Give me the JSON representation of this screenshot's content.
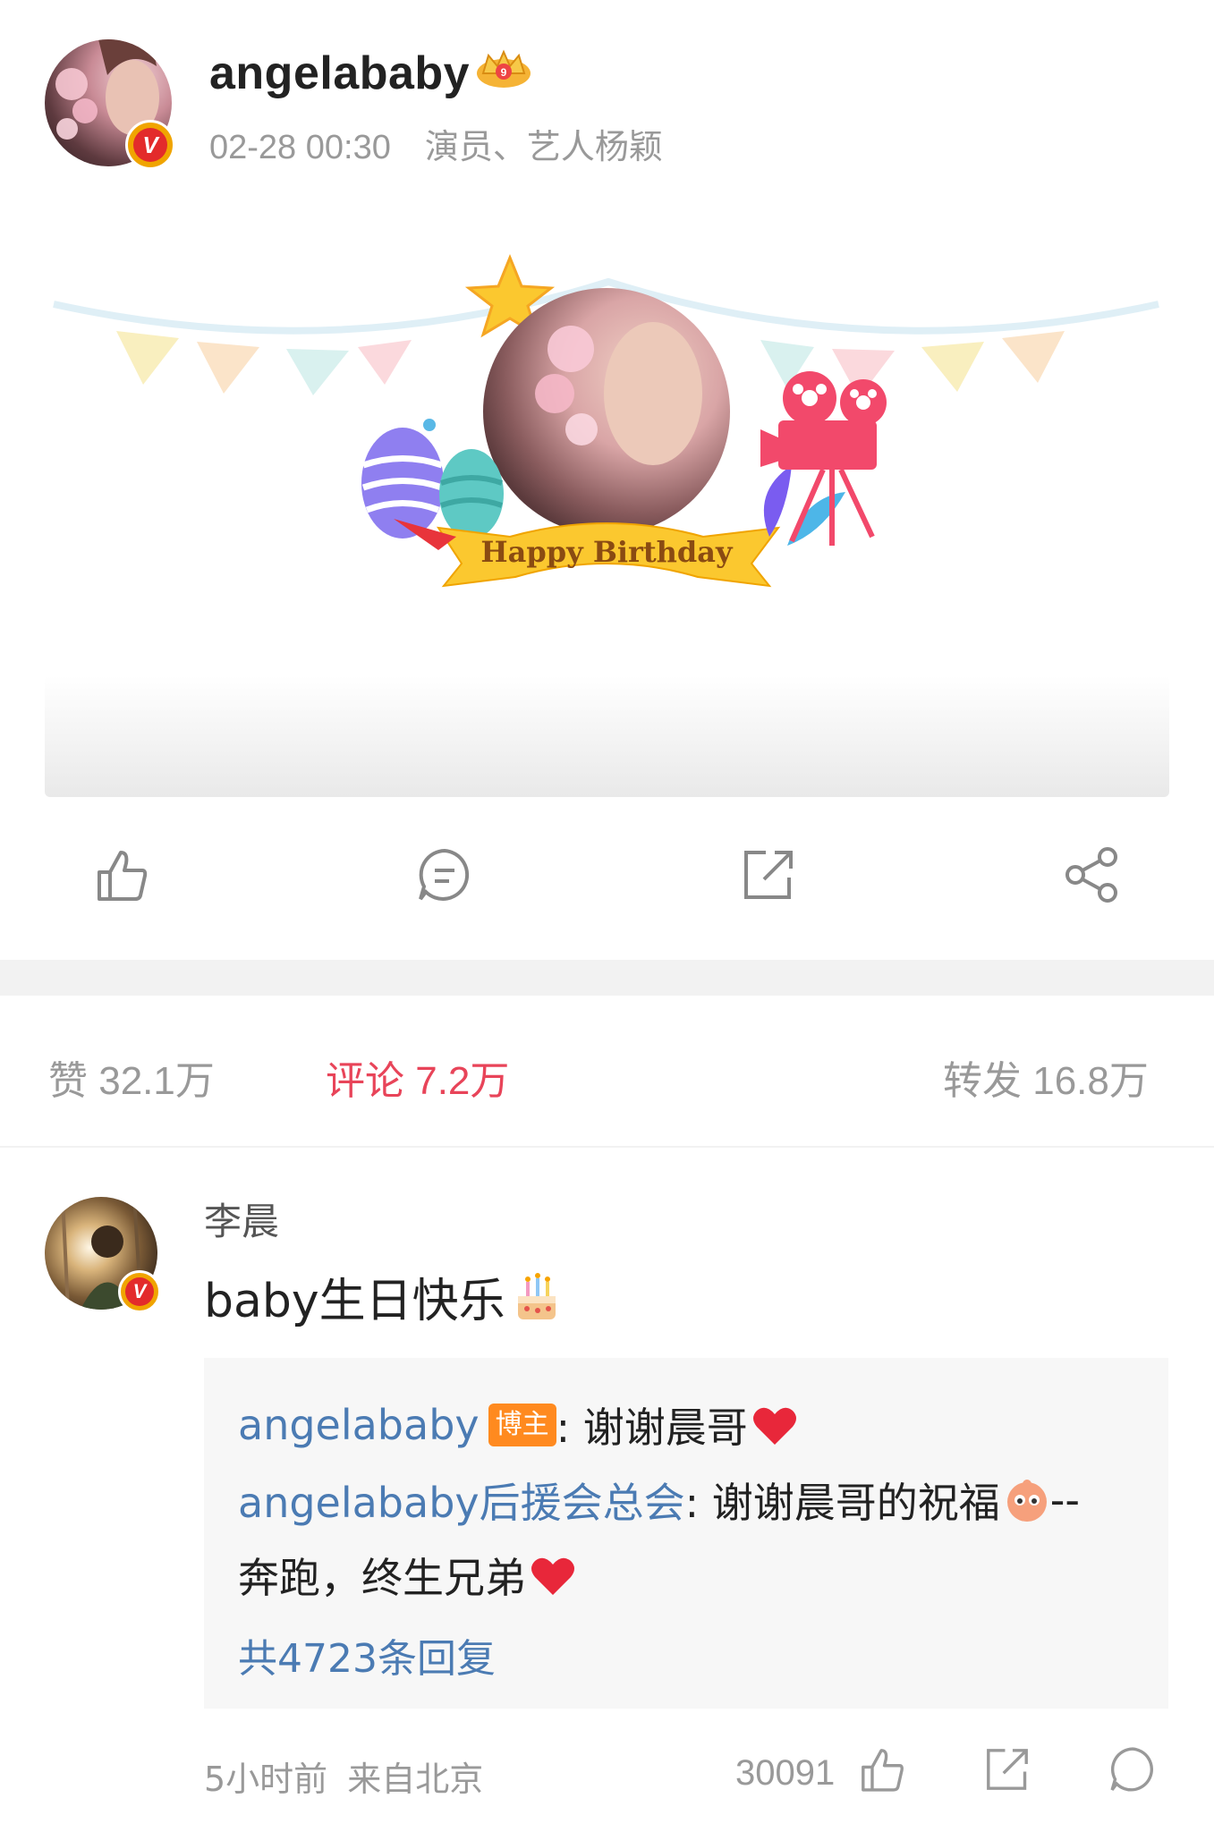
{
  "post": {
    "author": "angelababy",
    "time": "02-28 00:30",
    "description": "演员、艺人杨颖",
    "banner_text": "Happy Birthday"
  },
  "actions": {
    "icons": [
      "like-icon",
      "comment-icon",
      "repost-icon",
      "share-icon"
    ]
  },
  "tabs": [
    {
      "label": "赞 32.1万",
      "active": false
    },
    {
      "label": "评论 7.2万",
      "active": true
    },
    {
      "label": "转发 16.8万",
      "active": false
    }
  ],
  "comment": {
    "author": "李晨",
    "text": "baby生日快乐",
    "replies": [
      {
        "nick": "angelababy",
        "badge": "博主",
        "text": ": 谢谢晨哥"
      },
      {
        "nick": "angelababy后援会总会",
        "text": " : 谢谢晨哥的祝福",
        "cont": "--"
      },
      {
        "text": "奔跑，终生兄弟"
      }
    ],
    "more_replies": "共4723条回复",
    "time": "5小时前",
    "source": "来自北京",
    "like_count": "30091"
  },
  "colors": {
    "active_tab": "#e84459",
    "link": "#4b7bb3",
    "badge": "#ff8a1f",
    "verified": "#e32b2b"
  }
}
